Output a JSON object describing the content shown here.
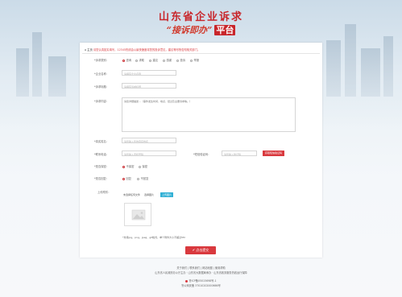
{
  "header": {
    "title_main": "山东省企业诉求",
    "title_sub_italic": "“接诉即办”",
    "title_sub_platform": "平台"
  },
  "breadcrumb": {
    "home": "主页",
    "notice": "请您认真如实填写，12345热线会以最快速度将您的投诉意见，建议等尽快告知相关部门。"
  },
  "form": {
    "type_label": "*诉求类别：",
    "type_options": [
      "咨询",
      "求助",
      "建议",
      "感谢",
      "投诉",
      "举报"
    ],
    "type_selected": "咨询",
    "company_label": "*企业名称：",
    "company_placeholder": "请填写企业名称",
    "subject_label": "*诉求标题：",
    "subject_placeholder": "请填写诉求标题",
    "content_label": "*诉求内容：",
    "content_placeholder": "请您详细描述…（事件发生时间、地点、经过及主要诉求等。）",
    "name_label": "*真实姓名：",
    "name_placeholder": "请您输入您的真实姓名",
    "phone_label": "*联系电话：",
    "phone_placeholder": "请您输入手机号码",
    "code_label": "*短信验证码：",
    "code_placeholder": "请您输入验证码",
    "code_button": "获取短信验证码",
    "public_label": "*是否保密：",
    "public_options": [
      "不保密",
      "保密"
    ],
    "public_selected": "不保密",
    "reply_label": "*是否回复：",
    "reply_options": [
      "回复",
      "不回复"
    ],
    "reply_selected": "回复",
    "upload_label": "上传附件：",
    "file_none": "未选择任何文件",
    "file_choose": "选择图片",
    "file_upload": "上传图片",
    "upload_hint": "*支持jpg、png、jpeg、gif格式，单个附件大小不超过5M",
    "submit": "✔ 点击提交"
  },
  "footer": {
    "line1": "关于我们 | 联系我们 | 网站地图 | 使用帮助",
    "line2": "山东省人民政府办公厅主办 · 山东省大数据局承办 · 山东省政务服务热线运行保障",
    "line3": "鲁ICP备05015698号-1",
    "line4": "鲁公网安备 37010202000666号"
  },
  "colors": {
    "brand_red": "#c8262b",
    "button_red": "#d9393e",
    "upload_blue": "#31b0d5"
  }
}
